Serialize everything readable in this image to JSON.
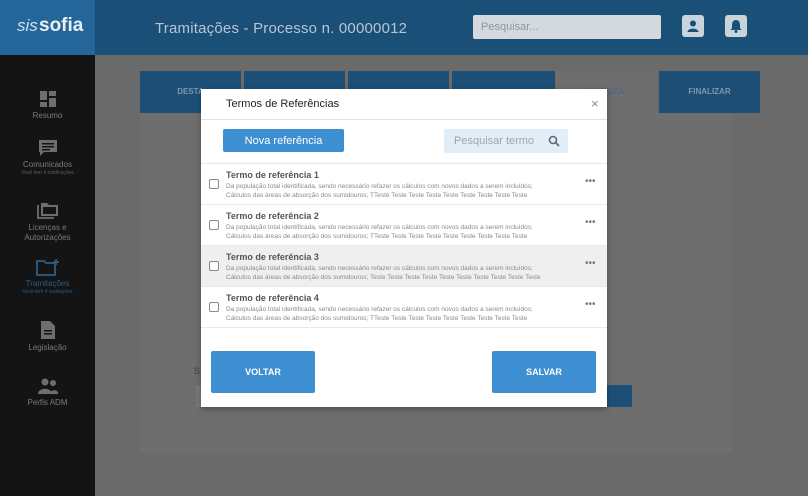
{
  "brand": {
    "prefix": "sis",
    "name": "sofia"
  },
  "header": {
    "title": "Tramitações - Processo n. 00000012",
    "search_placeholder": "Pesquisar..."
  },
  "sidebar": {
    "items": [
      {
        "label": "Resumo",
        "sub": ""
      },
      {
        "label": "Comunicados",
        "sub": "Você tem 4 notificações"
      },
      {
        "label": "Licenças e\nAutorizações",
        "sub": ""
      },
      {
        "label": "Tramitações",
        "sub": "Você tem 4 avaliações"
      },
      {
        "label": "Legislação",
        "sub": ""
      },
      {
        "label": "Perfis ADM",
        "sub": ""
      }
    ]
  },
  "tabs": [
    {
      "label": "DESTA"
    },
    {
      "label": ""
    },
    {
      "label": ""
    },
    {
      "label": ""
    },
    {
      "label": "TECNICA"
    },
    {
      "label": "FINALIZAR"
    }
  ],
  "background": {
    "s_label": "S"
  },
  "modal": {
    "title": "Termos de Referências",
    "close": "×",
    "new_button": "Nova referência",
    "search_placeholder": "Pesquisar termo",
    "rows": [
      {
        "title": "Termo de referência 1",
        "line1": "Da população total identificada, sendo necessário refazer os cálculos com novos dados a serem incluídos;",
        "line2": "Cálculos das áreas de absorção dos sumidouros; TTeste Teste Teste Teste Teste Teste Teste Teste Teste"
      },
      {
        "title": "Termo de referência 2",
        "line1": "Da população total identificada, sendo necessário refazer os cálculos com novos dados a serem incluídos;",
        "line2": "Cálculos das áreas de absorção dos sumidouros; TTeste Teste Teste Teste Teste Teste Teste Teste Teste"
      },
      {
        "title": "Termo de referência 3",
        "line1": "Da população total identificada, sendo necessário refazer os cálculos com novos dados a serem incluídos;",
        "line2": "Cálculos das áreas de absorção dos sumidouros; Teste Teste Teste Teste Teste Teste Teste Teste Teste Teste"
      },
      {
        "title": "Termo de referência 4",
        "line1": "Da população total identificada, sendo necessário refazer os cálculos com novos dados a serem incluídos;",
        "line2": "Cálculos das áreas de absorção dos sumidouros; TTeste Teste Teste Teste Teste Teste Teste Teste Teste"
      }
    ],
    "more": "•••",
    "back_button": "VOLTAR",
    "save_button": "SALVAR"
  },
  "colors": {
    "primary": "#3d8fd1",
    "header_bg": "#1a4f77",
    "sidebar_bg": "#141414"
  }
}
